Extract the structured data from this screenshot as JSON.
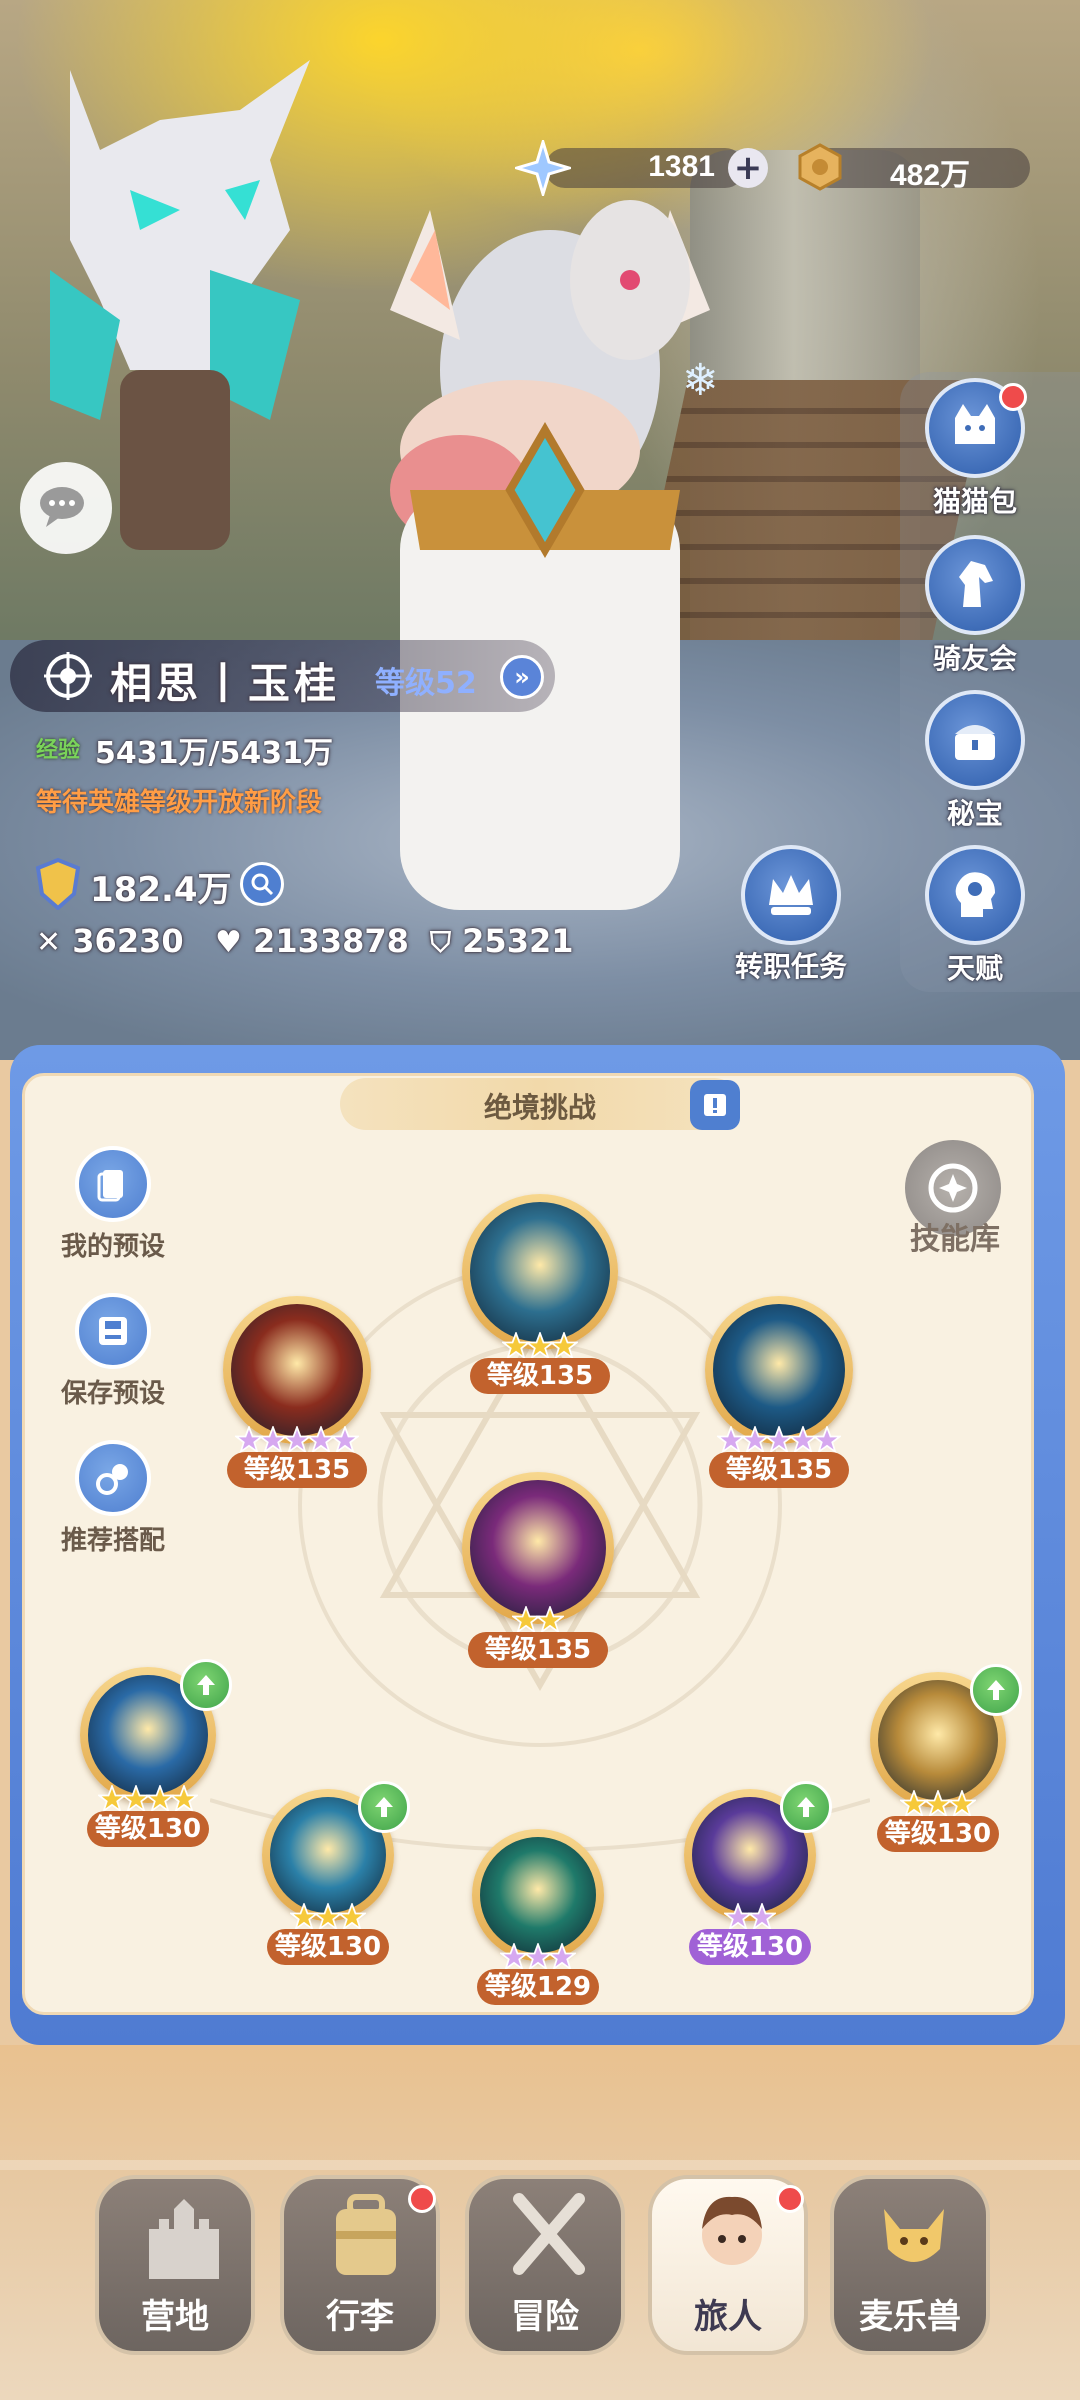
{
  "currency": {
    "crystal_icon": "snowflake-crystal-icon",
    "crystal_value": "1381",
    "add_icon": "plus-icon",
    "gold_icon": "gold-coin-icon",
    "gold_value": "482万"
  },
  "side_menu": [
    {
      "label": "猫猫包",
      "icon": "cat-bag-icon",
      "badge": true
    },
    {
      "label": "骑友会",
      "icon": "horse-head-icon",
      "badge": false
    },
    {
      "label": "秘宝",
      "icon": "treasure-chest-icon",
      "badge": false
    },
    {
      "label": "天赋",
      "icon": "head-gear-icon",
      "badge": false
    }
  ],
  "job_task": {
    "label": "转职任务",
    "icon": "crown-icon"
  },
  "hero": {
    "name": "相思丨玉桂",
    "level": "等级52",
    "exp_label": "经验",
    "exp": "5431万/5431万",
    "notice": "等待英雄等级开放新阶段",
    "power": "182.4万",
    "attack": "36230",
    "hp": "2133878",
    "defense": "25321"
  },
  "panel": {
    "title": "绝境挑战",
    "skill_library": "技能库",
    "left_buttons": [
      {
        "label": "我的预设",
        "icon": "preset-cards-icon"
      },
      {
        "label": "保存预设",
        "icon": "save-disk-icon"
      },
      {
        "label": "推荐搭配",
        "icon": "recommend-combo-icon"
      }
    ]
  },
  "skills": [
    {
      "level": "等级135",
      "stars": 3,
      "star_color": "gold",
      "label_color": "orange",
      "upgrade": false,
      "theme": "#2d6f8f"
    },
    {
      "level": "等级135",
      "stars": 5,
      "star_color": "purple",
      "label_color": "orange",
      "upgrade": false,
      "theme": "#8a2c1e"
    },
    {
      "level": "等级135",
      "stars": 5,
      "star_color": "purple",
      "label_color": "orange",
      "upgrade": false,
      "theme": "#1d5a86"
    },
    {
      "level": "等级135",
      "stars": 2,
      "star_color": "gold",
      "label_color": "orange",
      "upgrade": false,
      "theme": "#7a2a7a"
    },
    {
      "level": "等级130",
      "stars": 4,
      "star_color": "gold",
      "label_color": "orange",
      "upgrade": true,
      "theme": "#2a6aa6"
    },
    {
      "level": "等级130",
      "stars": 3,
      "star_color": "gold",
      "label_color": "orange",
      "upgrade": true,
      "theme": "#2b80a8"
    },
    {
      "level": "等级129",
      "stars": 3,
      "star_color": "purple",
      "label_color": "orange",
      "upgrade": false,
      "theme": "#1f7a6a"
    },
    {
      "level": "等级130",
      "stars": 2,
      "star_color": "purple",
      "label_color": "purple",
      "upgrade": true,
      "theme": "#5a3b9a"
    },
    {
      "level": "等级130",
      "stars": 3,
      "star_color": "gold",
      "label_color": "orange",
      "upgrade": true,
      "theme": "#b78a3a"
    }
  ],
  "bottom_nav": [
    {
      "label": "营地",
      "icon": "castle-icon",
      "badge": false,
      "active": false
    },
    {
      "label": "行李",
      "icon": "backpack-icon",
      "badge": true,
      "active": false
    },
    {
      "label": "冒险",
      "icon": "crossed-swords-icon",
      "badge": false,
      "active": false
    },
    {
      "label": "旅人",
      "icon": "traveler-avatar-icon",
      "badge": true,
      "active": true
    },
    {
      "label": "麦乐兽",
      "icon": "fox-pet-icon",
      "badge": false,
      "active": false
    }
  ]
}
